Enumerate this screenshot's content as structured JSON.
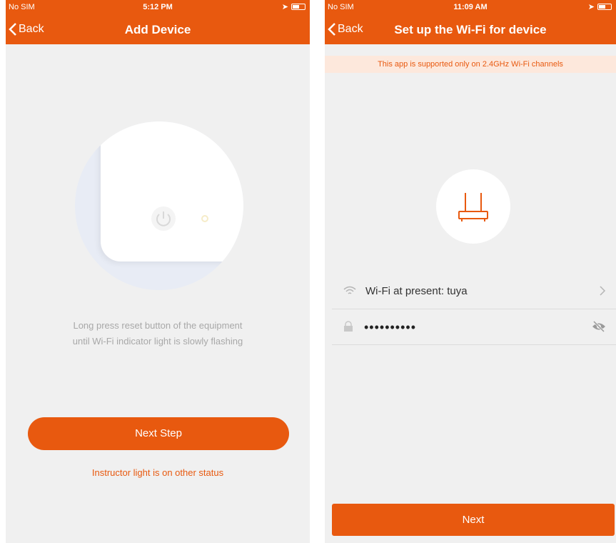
{
  "colors": {
    "accent": "#e8590f",
    "background": "#f0f0f0",
    "banner_bg": "#fde8dc"
  },
  "left": {
    "status": {
      "carrier": "No SIM",
      "time": "5:12 PM"
    },
    "nav": {
      "back_label": "Back",
      "title": "Add Device"
    },
    "instruction_line1": "Long press reset button of the equipment",
    "instruction_line2": "until Wi-Fi indicator light is slowly flashing",
    "next_step_label": "Next Step",
    "other_status_link": "Instructor light is on other status"
  },
  "right": {
    "status": {
      "carrier": "No SIM",
      "time": "11:09 AM"
    },
    "nav": {
      "back_label": "Back",
      "title": "Set up the Wi-Fi for device"
    },
    "banner": "This app is supported only on 2.4GHz Wi-Fi channels",
    "wifi_label": "Wi-Fi at present: tuya",
    "password_value": "••••••••••",
    "next_label": "Next"
  },
  "icons": [
    "wifi-icon",
    "lock-icon",
    "chevron-right-icon",
    "eye-off-icon",
    "router-icon",
    "power-icon",
    "back-chevron-icon"
  ]
}
